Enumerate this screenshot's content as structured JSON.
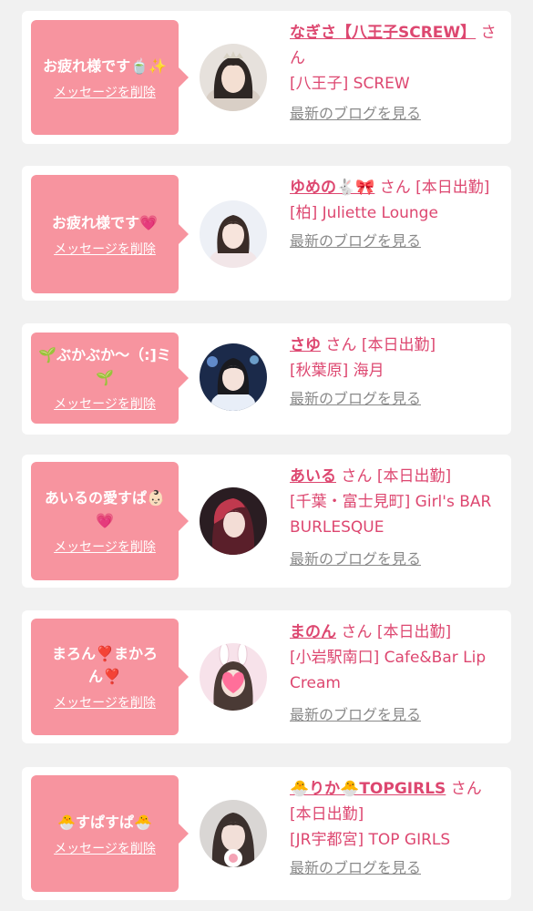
{
  "colors": {
    "accent": "#dd4770",
    "bubble": "#f7949f",
    "background": "#f1f1f1",
    "link_gray": "#8a8a8a"
  },
  "delete_label": "メッセージを削除",
  "blog_label": "最新のブログを見る",
  "cards": [
    {
      "message": "お疲れ様です🍵✨",
      "name": "なぎさ【八王子SCREW】",
      "honorific": "さん",
      "status": "",
      "shop": "[八王子] SCREW",
      "avatar_icon": "woman-portrait-icon"
    },
    {
      "message": "お疲れ様です💗",
      "name": "ゆめの🐇🎀",
      "honorific": "さん",
      "status": "[本日出勤]",
      "shop": "[柏] Juliette Lounge",
      "avatar_icon": "woman-portrait-icon"
    },
    {
      "message": "🌱ぶかぶか〜（:]ミ🌱",
      "name": "さゆ",
      "honorific": "さん",
      "status": "[本日出勤]",
      "shop": "[秋葉原] 海月",
      "avatar_icon": "woman-portrait-icon"
    },
    {
      "message": "あいるの愛すぱ👶🏻💗",
      "name": "あいる",
      "honorific": "さん",
      "status": "[本日出勤]",
      "shop": "[千葉・富士見町] Girl's BAR BURLESQUE",
      "avatar_icon": "woman-portrait-icon"
    },
    {
      "message": "まろん❣️まかろん❣️",
      "name": "まのん",
      "honorific": "さん",
      "status": "[本日出勤]",
      "shop": "[小岩駅南口] Cafe&Bar Lip Cream",
      "avatar_icon": "heart-face-portrait-icon"
    },
    {
      "message": "🐣すぱすぱ🐣",
      "name": "🐣りか🐣TOPGIRLS",
      "honorific": "さん",
      "status": "[本日出勤]",
      "shop": "[JR宇都宮] TOP GIRLS",
      "avatar_icon": "woman-portrait-icon"
    }
  ]
}
